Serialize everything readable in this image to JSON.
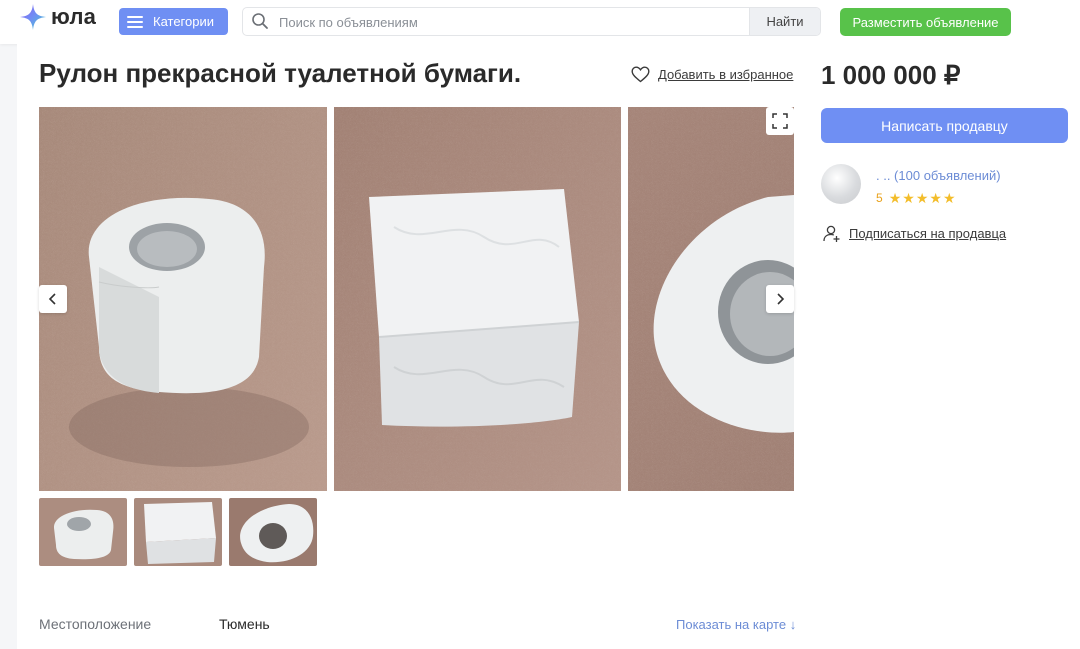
{
  "header": {
    "logo_text": "юла",
    "categories_label": "Категории",
    "search_placeholder": "Поиск по объявлениям",
    "search_button": "Найти",
    "post_button": "Разместить объявление"
  },
  "listing": {
    "title": "Рулон прекрасной туалетной бумаги.",
    "favorite_label": "Добавить в избранное",
    "price": "1 000 000 ₽",
    "location_label": "Местоположение",
    "location_value": "Тюмень",
    "show_map_label": "Показать на карте ↓"
  },
  "seller": {
    "message_button": "Написать продавцу",
    "ads_text": ". .. (100 объявлений)",
    "rating_value": "5",
    "stars": 5,
    "subscribe_label": "Подписаться на продавца"
  },
  "gallery": {
    "photos": [
      "toilet-paper-roll-photo",
      "folded-toilet-paper-photo",
      "toilet-paper-roll-closeup-photo"
    ],
    "thumbnails": 3
  },
  "colors": {
    "accent_blue": "#6f8ff3",
    "post_green": "#58c24a",
    "link_blue": "#6c8cd5",
    "star_yellow": "#f3bd2b"
  },
  "icons": [
    "yula-logo-icon",
    "menu-icon",
    "search-icon",
    "heart-icon",
    "expand-icon",
    "chevron-left-icon",
    "chevron-right-icon",
    "star-icon",
    "subscribe-user-icon"
  ]
}
